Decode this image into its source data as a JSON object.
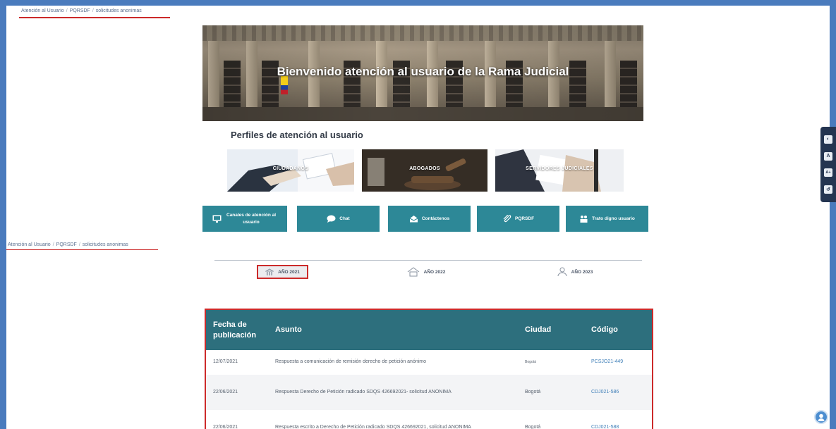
{
  "breadcrumb": {
    "items": [
      "Atención al Usuario",
      "PQRSDF",
      "solicitudes anonimas"
    ],
    "separator": "/"
  },
  "hero": {
    "title": "Bienvenido atención al usuario de la Rama Judicial"
  },
  "profiles": {
    "title": "Perfiles de atención al usuario",
    "items": [
      {
        "label": "CIUDADANOS"
      },
      {
        "label": "ABOGADOS"
      },
      {
        "label": "SERVIDORES JUDICIALES"
      }
    ]
  },
  "actions": [
    {
      "label": "Canales de atención al usuario",
      "icon": "monitor-icon"
    },
    {
      "label": "Chat",
      "icon": "chat-icon"
    },
    {
      "label": "Contáctenos",
      "icon": "contact-icon"
    },
    {
      "label": "PQRSDF",
      "icon": "attachment-icon"
    },
    {
      "label": "Trato digno usuario",
      "icon": "people-icon"
    }
  ],
  "years": {
    "tabs": [
      {
        "label": "AÑO 2021",
        "active": true,
        "icon": "building-icon"
      },
      {
        "label": "AÑO 2022",
        "active": false,
        "icon": "house-icon"
      },
      {
        "label": "AÑO 2023",
        "active": false,
        "icon": "person-icon"
      }
    ]
  },
  "table": {
    "columns": [
      "Fecha de publicación",
      "Asunto",
      "Ciudad",
      "Código"
    ],
    "rows": [
      {
        "fecha": "12/07/2021",
        "asunto": "Respuesta a comunicación de remisión derecho de petición anónimo",
        "ciudad": "Bogotá",
        "codigo": "PCSJO21-449"
      },
      {
        "fecha": "22/06/2021",
        "asunto": "Respuesta Derecho de Petición radicado SDQS 426692021- solicitud ANONIMA",
        "ciudad": "Bogotá",
        "codigo": "CDJ021-586"
      },
      {
        "fecha": "22/06/2021",
        "asunto": "Respuesta escrito a Derecho de Petición radicado SDQS 426692021, solicitud ANONIMA",
        "ciudad": "Bogotá",
        "codigo": "CDJ021-588"
      }
    ]
  },
  "side_tools": [
    {
      "icon": "contrast-icon",
      "glyph": "◐"
    },
    {
      "icon": "font-decrease-icon",
      "glyph": "A"
    },
    {
      "icon": "font-increase-icon",
      "glyph": "A+"
    },
    {
      "icon": "reset-icon",
      "glyph": "↺"
    }
  ],
  "colors": {
    "frame": "#4a7bbd",
    "teal_button": "#2d8897",
    "table_header": "#2d6f7d",
    "highlight": "#cc2a2a",
    "link": "#3f7fb8"
  }
}
